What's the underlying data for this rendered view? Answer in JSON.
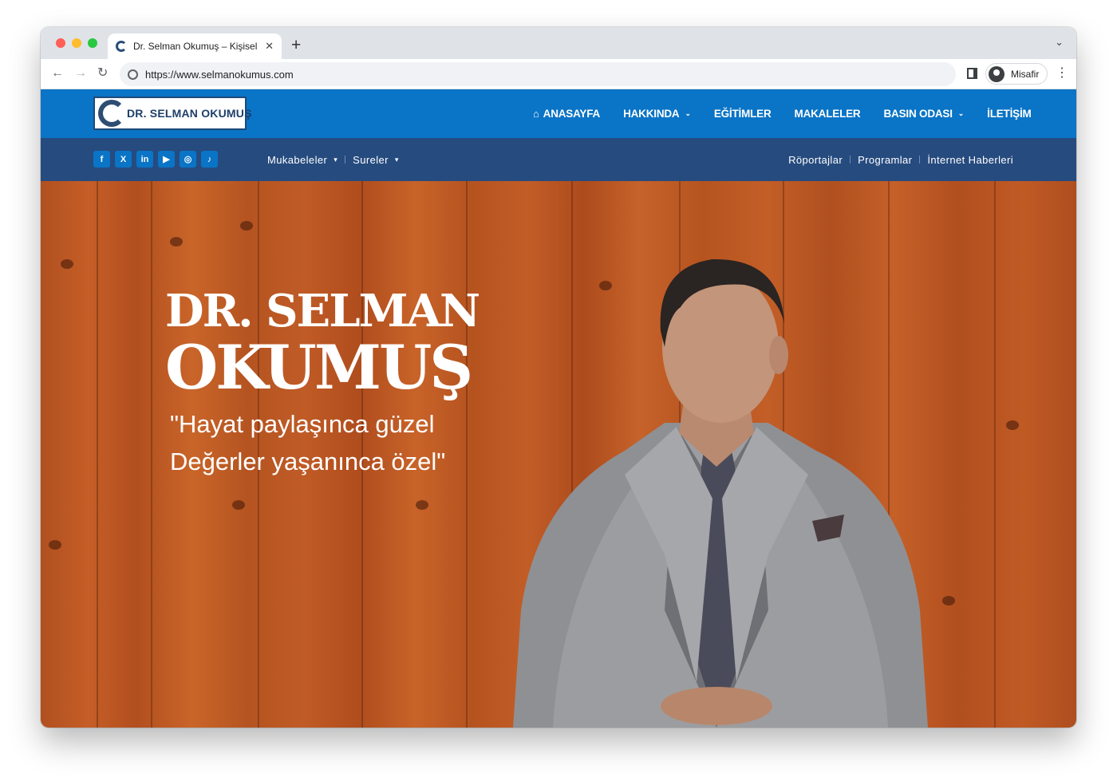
{
  "browser": {
    "tab_title": "Dr. Selman Okumuş – Kişisel W",
    "tab_close": "✕",
    "new_tab": "+",
    "tabs_menu": "⌄",
    "url": "https://www.selmanokumus.com",
    "profile_name": "Misafir",
    "back": "←",
    "forward": "→",
    "reload": "↻",
    "menu": "⋮",
    "traffic_lights": [
      "#ff5f57",
      "#febc2e",
      "#28c840"
    ]
  },
  "header": {
    "logo_text": "DR. SELMAN OKUMUŞ",
    "nav": [
      {
        "label": "ANASAYFA",
        "icon": "home-icon"
      },
      {
        "label": "HAKKINDA",
        "dropdown": true
      },
      {
        "label": "EĞİTİMLER"
      },
      {
        "label": "MAKALELER"
      },
      {
        "label": "BASIN ODASI",
        "dropdown": true
      },
      {
        "label": "İLETİŞİM"
      }
    ],
    "home_glyph": "⌂",
    "caret": "⌄"
  },
  "subheader": {
    "socials": [
      {
        "name": "facebook-icon",
        "glyph": "f"
      },
      {
        "name": "x-icon",
        "glyph": "X"
      },
      {
        "name": "linkedin-icon",
        "glyph": "in"
      },
      {
        "name": "youtube-icon",
        "glyph": "▶"
      },
      {
        "name": "instagram-icon",
        "glyph": "◎"
      },
      {
        "name": "tiktok-icon",
        "glyph": "♪"
      }
    ],
    "left_menu": [
      "Mukabeleler",
      "Sureler"
    ],
    "right_menu": [
      "Röportajlar",
      "Programlar",
      "İnternet Haberleri"
    ],
    "caret": "▾"
  },
  "hero": {
    "name_line1": "DR. SELMAN",
    "name_line2": "OKUMUŞ",
    "quote_line1": "\"Hayat paylaşınca güzel",
    "quote_line2": "Değerler yaşanınca özel\""
  },
  "colors": {
    "header_blue": "#0a74c6",
    "subheader_navy": "#264b7f",
    "wood": "#b9551f"
  }
}
